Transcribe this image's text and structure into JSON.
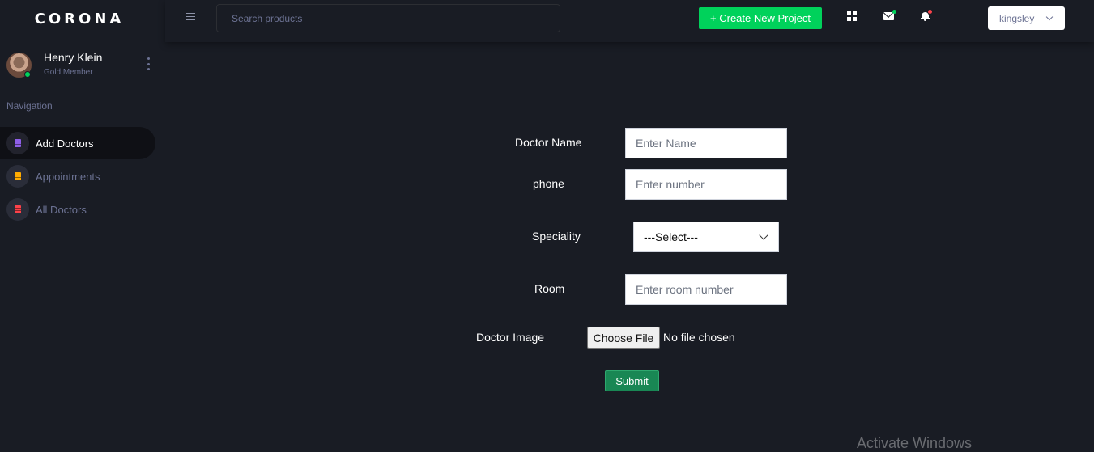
{
  "brand": {
    "name": "CORONA"
  },
  "profile": {
    "name": "Henry Klein",
    "rank": "Gold Member"
  },
  "nav": {
    "caption": "Navigation",
    "items": [
      {
        "label": "Add Doctors",
        "icon": "document-icon",
        "color": "#8f5fe8",
        "active": true
      },
      {
        "label": "Appointments",
        "icon": "document-icon",
        "color": "#ffab00",
        "active": false
      },
      {
        "label": "All Doctors",
        "icon": "document-icon",
        "color": "#fc424a",
        "active": false
      }
    ]
  },
  "topbar": {
    "search_placeholder": "Search products",
    "create_label": "+ Create New Project",
    "user": "kingsley"
  },
  "form": {
    "name_label": "Doctor Name",
    "name_placeholder": "Enter Name",
    "phone_label": "phone",
    "phone_placeholder": "Enter number",
    "speciality_label": "Speciality",
    "speciality_value": "---Select---",
    "room_label": "Room",
    "room_placeholder": "Enter room number",
    "image_label": "Doctor Image",
    "file_button": "Choose File",
    "file_status": "No file chosen",
    "submit_label": "Submit"
  },
  "watermark": "Activate Windows",
  "colors": {
    "background": "#191c24",
    "accent_green": "#00d25b",
    "submit_green": "#198754",
    "muted_text": "#6c7293"
  }
}
